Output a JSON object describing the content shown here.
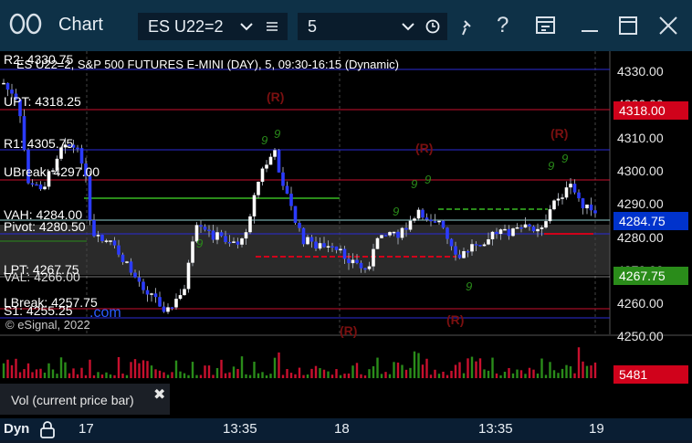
{
  "titlebar": {
    "app_icon": "two-circles",
    "title": "Chart",
    "symbol": "ES U22=2",
    "interval": "5",
    "icons": [
      "chevron-down-icon",
      "list-icon",
      "clock-icon",
      "pin-icon",
      "help-icon",
      "layout-icon",
      "minimize-icon",
      "maximize-icon",
      "close-icon"
    ]
  },
  "chart": {
    "header": "ES U22=2, S&P 500 FUTURES E-MINI (DAY), 5, 09:30-16:15 (Dynamic)",
    "copyright": "© eSignal, 2022",
    "small_link": ".com",
    "price_ticks": [
      "4330.00",
      "4320.00",
      "4310.00",
      "4300.00",
      "4290.00",
      "4280.00",
      "4270.00",
      "4260.00",
      "4250.00"
    ],
    "price_tags": [
      {
        "label": "4318.00",
        "color": "#d0021b"
      },
      {
        "label": "4284.75",
        "color": "#0033cc"
      },
      {
        "label": "4267.75",
        "color": "#2a8c1a"
      }
    ],
    "levels": [
      {
        "label": "R2: 4330.75",
        "color": "#2b2bd6"
      },
      {
        "label": "UPT: 4318.25",
        "color": "#c8102e"
      },
      {
        "label": "R1: 4305.75",
        "color": "#2b2bd6"
      },
      {
        "label": "UBreak: 4297.00",
        "color": "#c8102e"
      },
      {
        "label": "VAH: 4284.00",
        "color": "#c8c8c8"
      },
      {
        "label": "Pivot: 4280.50",
        "color": "#2b2bd6"
      },
      {
        "label": "LPT: 4267.75",
        "color": "#2a8c1a"
      },
      {
        "label": "VAL: 4266.00",
        "color": "#c8c8c8"
      },
      {
        "label": "LBreak: 4257.75",
        "color": "#c8102e"
      },
      {
        "label": "S1: 4255.25",
        "color": "#2b2bd6"
      }
    ],
    "r_markers": [
      "(R)",
      "(R)",
      "(R)",
      "(R)",
      "(R)"
    ],
    "volume_tag": "5481",
    "volume_tag_color": "#d0021b",
    "volume_label": "Vol (current price bar)"
  },
  "time_axis": {
    "dyn_label": "Dyn",
    "labels": [
      "17",
      "13:35",
      "18",
      "13:35",
      "19"
    ]
  }
}
